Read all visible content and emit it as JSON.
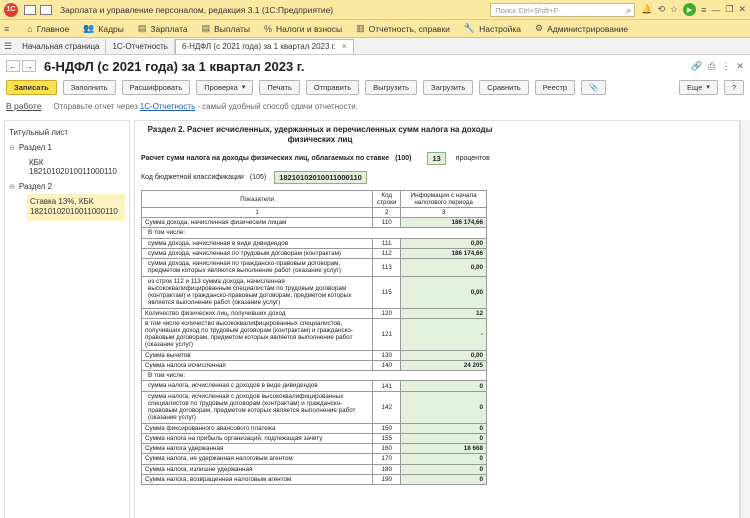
{
  "titlebar": {
    "logo": "1С",
    "title": "Зарплата и управление персоналом, редакция 3.1  (1С:Предприятие)",
    "search_placeholder": "Поиск Ctrl+Shift+F"
  },
  "menu": [
    {
      "icon": "≡",
      "label": ""
    },
    {
      "icon": "⌂",
      "label": "Главное"
    },
    {
      "icon": "👥",
      "label": "Кадры"
    },
    {
      "icon": "▤",
      "label": "Зарплата"
    },
    {
      "icon": "▤",
      "label": "Выплаты"
    },
    {
      "icon": "%",
      "label": "Налоги и взносы"
    },
    {
      "icon": "▥",
      "label": "Отчетность, справки"
    },
    {
      "icon": "🔧",
      "label": "Настройка"
    },
    {
      "icon": "⚙",
      "label": "Администрирование"
    }
  ],
  "tabs": [
    {
      "label": "Начальная страница"
    },
    {
      "label": "1С-Отчетность"
    },
    {
      "label": "6-НДФЛ (с 2021 года) за 1 квартал 2023 г."
    }
  ],
  "doc": {
    "title": "6-НДФЛ (с 2021 года) за 1 квартал 2023 г."
  },
  "toolbar": {
    "save": "Записать",
    "fill": "Заполнить",
    "decode": "Расшифровать",
    "check": "Проверка",
    "print": "Печать",
    "send": "Отправить",
    "upload": "Выгрузить",
    "download": "Загрузить",
    "compare": "Сравнить",
    "registry": "Реестр",
    "more": "Еще",
    "help": "?"
  },
  "info": {
    "status": "В работе",
    "text1": "Отправьте отчет через",
    "link": "1С-Отчетность",
    "text2": "- самый удобный способ сдачи отчетности."
  },
  "tree": {
    "title_sheet": "Титульный лист",
    "section1": "Раздел 1",
    "kbk": "КБК 18210102010011000110",
    "section2": "Раздел 2",
    "selected": "Ставка 13%, КБК 18210102010011000110"
  },
  "form": {
    "section_title": "Раздел 2. Расчет исчисленных, удержанных и перечисленных сумм налога на доходы физических лиц",
    "rate_label": "Расчет сумм налога на доходы физических лиц, облагаемых по ставке",
    "rate_code": "(100)",
    "rate_value": "13",
    "rate_unit": "процентов",
    "kbk_label": "Код бюджетной классификации",
    "kbk_code": "(105)",
    "kbk_value": "18210102010011000110",
    "col_indicators": "Показатели",
    "col_code": "Код строки",
    "col_info": "Информация с начала налогового периода",
    "col_num1": "1",
    "col_num2": "2",
    "col_num3": "3",
    "rows": [
      {
        "label": "Сумма дохода, начисленная физическим лицам",
        "code": "110",
        "value": "186 174,66"
      },
      {
        "label": "В том числе:",
        "code": "",
        "value": ""
      },
      {
        "label": "сумма дохода, начисленная в виде дивидендов",
        "code": "111",
        "value": "0,00"
      },
      {
        "label": "сумма дохода, начисленная по трудовым договорам (контрактам)",
        "code": "112",
        "value": "186 174,66"
      },
      {
        "label": "сумма дохода, начисленная по гражданско-правовым договорам, предметом которых являются выполнение работ (оказание услуг)",
        "code": "113",
        "value": "0,00"
      },
      {
        "label": "из строк 112 и 113 сумма дохода, начисленная высококвалифицированным специалистам по трудовым договорам (контрактам) и гражданско-правовым договорам, предметом которых является выполнение работ (оказание услуг)",
        "code": "115",
        "value": "0,00"
      },
      {
        "label": "Количество физических лиц, получивших доход",
        "code": "120",
        "value": "12"
      },
      {
        "label": "в том числе количество высококвалифицированных специалистов, получивших доход по трудовым договорам (контрактам) и гражданско-правовым договорам, предметом которых является выполнение работ (оказание услуг)",
        "code": "121",
        "value": "-"
      },
      {
        "label": "Сумма вычетов",
        "code": "130",
        "value": "0,00"
      },
      {
        "label": "Сумма налога исчисленная",
        "code": "140",
        "value": "24 205"
      },
      {
        "label": "В том числе:",
        "code": "",
        "value": ""
      },
      {
        "label": "сумма налога, исчисленная с доходов в виде дивидендов",
        "code": "141",
        "value": "0"
      },
      {
        "label": "сумма налога, исчисленная с доходов высококвалифицированных специалистов по трудовым договорам (контрактам) и гражданско-правовым договорам, предметом которых является выполнение работ (оказание услуг)",
        "code": "142",
        "value": "0"
      },
      {
        "label": "Сумма фиксированного авансового платежа",
        "code": "150",
        "value": "0"
      },
      {
        "label": "Сумма налога на прибыль организаций, подлежащая зачету",
        "code": "155",
        "value": "0"
      },
      {
        "label": "Сумма налога удержанная",
        "code": "160",
        "value": "18 668"
      },
      {
        "label": "Сумма налога, не удержанная налоговым агентом",
        "code": "170",
        "value": "0"
      },
      {
        "label": "Сумма налога, излишне удержанная",
        "code": "180",
        "value": "0"
      },
      {
        "label": "Сумма налога, возвращенная налоговым агентом",
        "code": "190",
        "value": "0"
      }
    ]
  }
}
